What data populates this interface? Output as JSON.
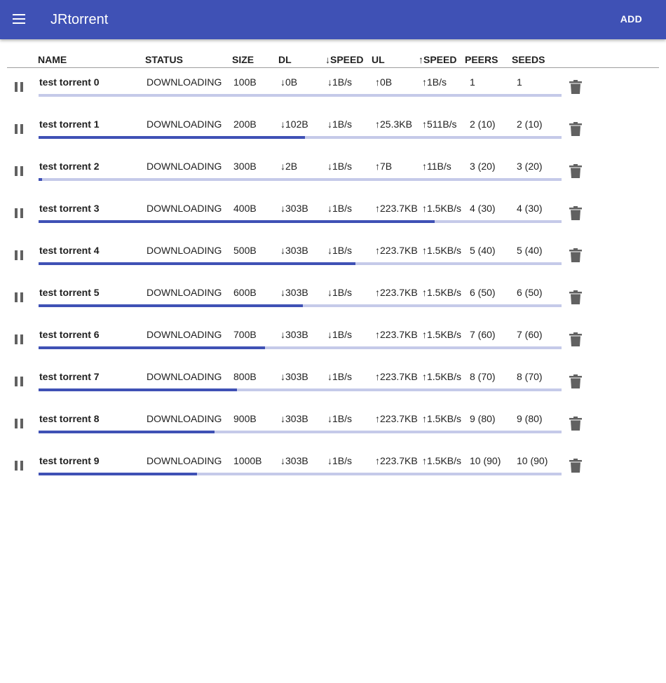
{
  "app": {
    "title": "JRtorrent",
    "add_label": "ADD"
  },
  "columns": [
    "NAME",
    "STATUS",
    "SIZE",
    "DL",
    "↓SPEED",
    "UL",
    "↑SPEED",
    "PEERS",
    "SEEDS"
  ],
  "colors": {
    "primary": "#3f51b5",
    "track": "#c5cae9",
    "icon": "#616161"
  },
  "torrents": [
    {
      "name": "test torrent 0",
      "status": "DOWNLOADING",
      "size": "100B",
      "dl": "↓0B",
      "dl_speed": "↓1B/s",
      "ul": "↑0B",
      "ul_speed": "↑1B/s",
      "peers": "1",
      "seeds": "1",
      "progress": 0
    },
    {
      "name": "test torrent 1",
      "status": "DOWNLOADING",
      "size": "200B",
      "dl": "↓102B",
      "dl_speed": "↓1B/s",
      "ul": "↑25.3KB",
      "ul_speed": "↑511B/s",
      "peers": "2 (10)",
      "seeds": "2 (10)",
      "progress": 0.51
    },
    {
      "name": "test torrent 2",
      "status": "DOWNLOADING",
      "size": "300B",
      "dl": "↓2B",
      "dl_speed": "↓1B/s",
      "ul": "↑7B",
      "ul_speed": "↑11B/s",
      "peers": "3 (20)",
      "seeds": "3 (20)",
      "progress": 0.0067
    },
    {
      "name": "test torrent 3",
      "status": "DOWNLOADING",
      "size": "400B",
      "dl": "↓303B",
      "dl_speed": "↓1B/s",
      "ul": "↑223.7KB",
      "ul_speed": "↑1.5KB/s",
      "peers": "4 (30)",
      "seeds": "4 (30)",
      "progress": 0.7575
    },
    {
      "name": "test torrent 4",
      "status": "DOWNLOADING",
      "size": "500B",
      "dl": "↓303B",
      "dl_speed": "↓1B/s",
      "ul": "↑223.7KB",
      "ul_speed": "↑1.5KB/s",
      "peers": "5 (40)",
      "seeds": "5 (40)",
      "progress": 0.606
    },
    {
      "name": "test torrent 5",
      "status": "DOWNLOADING",
      "size": "600B",
      "dl": "↓303B",
      "dl_speed": "↓1B/s",
      "ul": "↑223.7KB",
      "ul_speed": "↑1.5KB/s",
      "peers": "6 (50)",
      "seeds": "6 (50)",
      "progress": 0.505
    },
    {
      "name": "test torrent 6",
      "status": "DOWNLOADING",
      "size": "700B",
      "dl": "↓303B",
      "dl_speed": "↓1B/s",
      "ul": "↑223.7KB",
      "ul_speed": "↑1.5KB/s",
      "peers": "7 (60)",
      "seeds": "7 (60)",
      "progress": 0.4329
    },
    {
      "name": "test torrent 7",
      "status": "DOWNLOADING",
      "size": "800B",
      "dl": "↓303B",
      "dl_speed": "↓1B/s",
      "ul": "↑223.7KB",
      "ul_speed": "↑1.5KB/s",
      "peers": "8 (70)",
      "seeds": "8 (70)",
      "progress": 0.3788
    },
    {
      "name": "test torrent 8",
      "status": "DOWNLOADING",
      "size": "900B",
      "dl": "↓303B",
      "dl_speed": "↓1B/s",
      "ul": "↑223.7KB",
      "ul_speed": "↑1.5KB/s",
      "peers": "9 (80)",
      "seeds": "9 (80)",
      "progress": 0.3367
    },
    {
      "name": "test torrent 9",
      "status": "DOWNLOADING",
      "size": "1000B",
      "dl": "↓303B",
      "dl_speed": "↓1B/s",
      "ul": "↑223.7KB",
      "ul_speed": "↑1.5KB/s",
      "peers": "10 (90)",
      "seeds": "10 (90)",
      "progress": 0.303
    }
  ]
}
